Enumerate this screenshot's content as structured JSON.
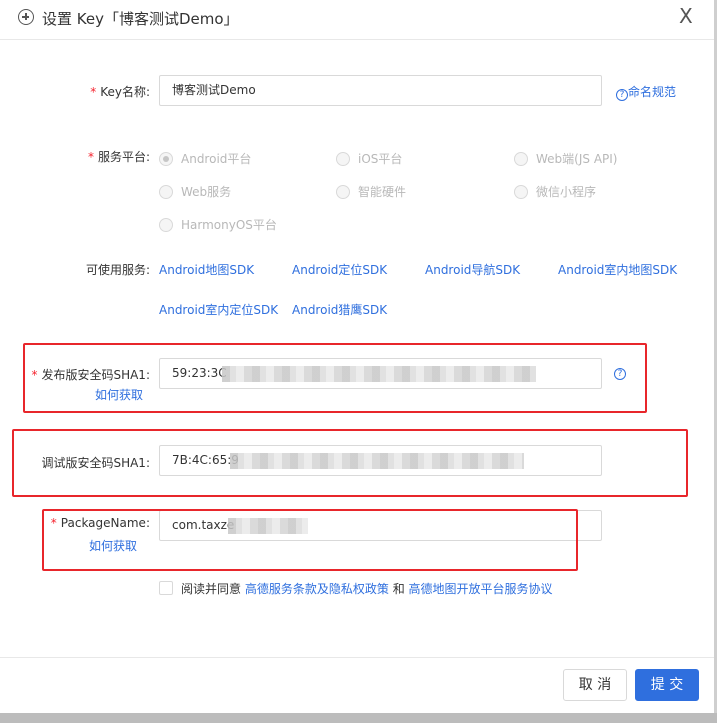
{
  "header": {
    "title": "设置 Key「博客测试Demo」",
    "close": "X"
  },
  "form": {
    "key_name": {
      "label": "Key名称",
      "value": "博客测试Demo",
      "help_link": "命名规范"
    },
    "platform": {
      "label": "服务平台",
      "options": [
        "Android平台",
        "iOS平台",
        "Web端(JS API)",
        "Web服务",
        "智能硬件",
        "微信小程序",
        "HarmonyOS平台"
      ],
      "selected": "Android平台"
    },
    "services": {
      "label": "可使用服务",
      "items": [
        "Android地图SDK",
        "Android定位SDK",
        "Android导航SDK",
        "Android室内地图SDK",
        "Android室内定位SDK",
        "Android猎鹰SDK"
      ]
    },
    "release_sha1": {
      "label": "发布版安全码SHA1",
      "value": "59:23:3C",
      "how_link": "如何获取"
    },
    "debug_sha1": {
      "label": "调试版安全码SHA1",
      "value": "7B:4C:65:9"
    },
    "package_name": {
      "label": "PackageName",
      "value": "com.taxze",
      "how_link": "如何获取"
    },
    "agreement": {
      "prefix": "阅读并同意",
      "link1": "高德服务条款及隐私权政策",
      "and": "和",
      "link2": "高德地图开放平台服务协议"
    }
  },
  "footer": {
    "cancel": "取 消",
    "submit": "提 交"
  },
  "colors": {
    "link": "#2f6fde",
    "required": "#f5222d",
    "annotation": "#e8262b",
    "primary": "#2f6fde"
  },
  "icons": [
    "plus-circle-icon",
    "close-icon",
    "help-icon"
  ]
}
